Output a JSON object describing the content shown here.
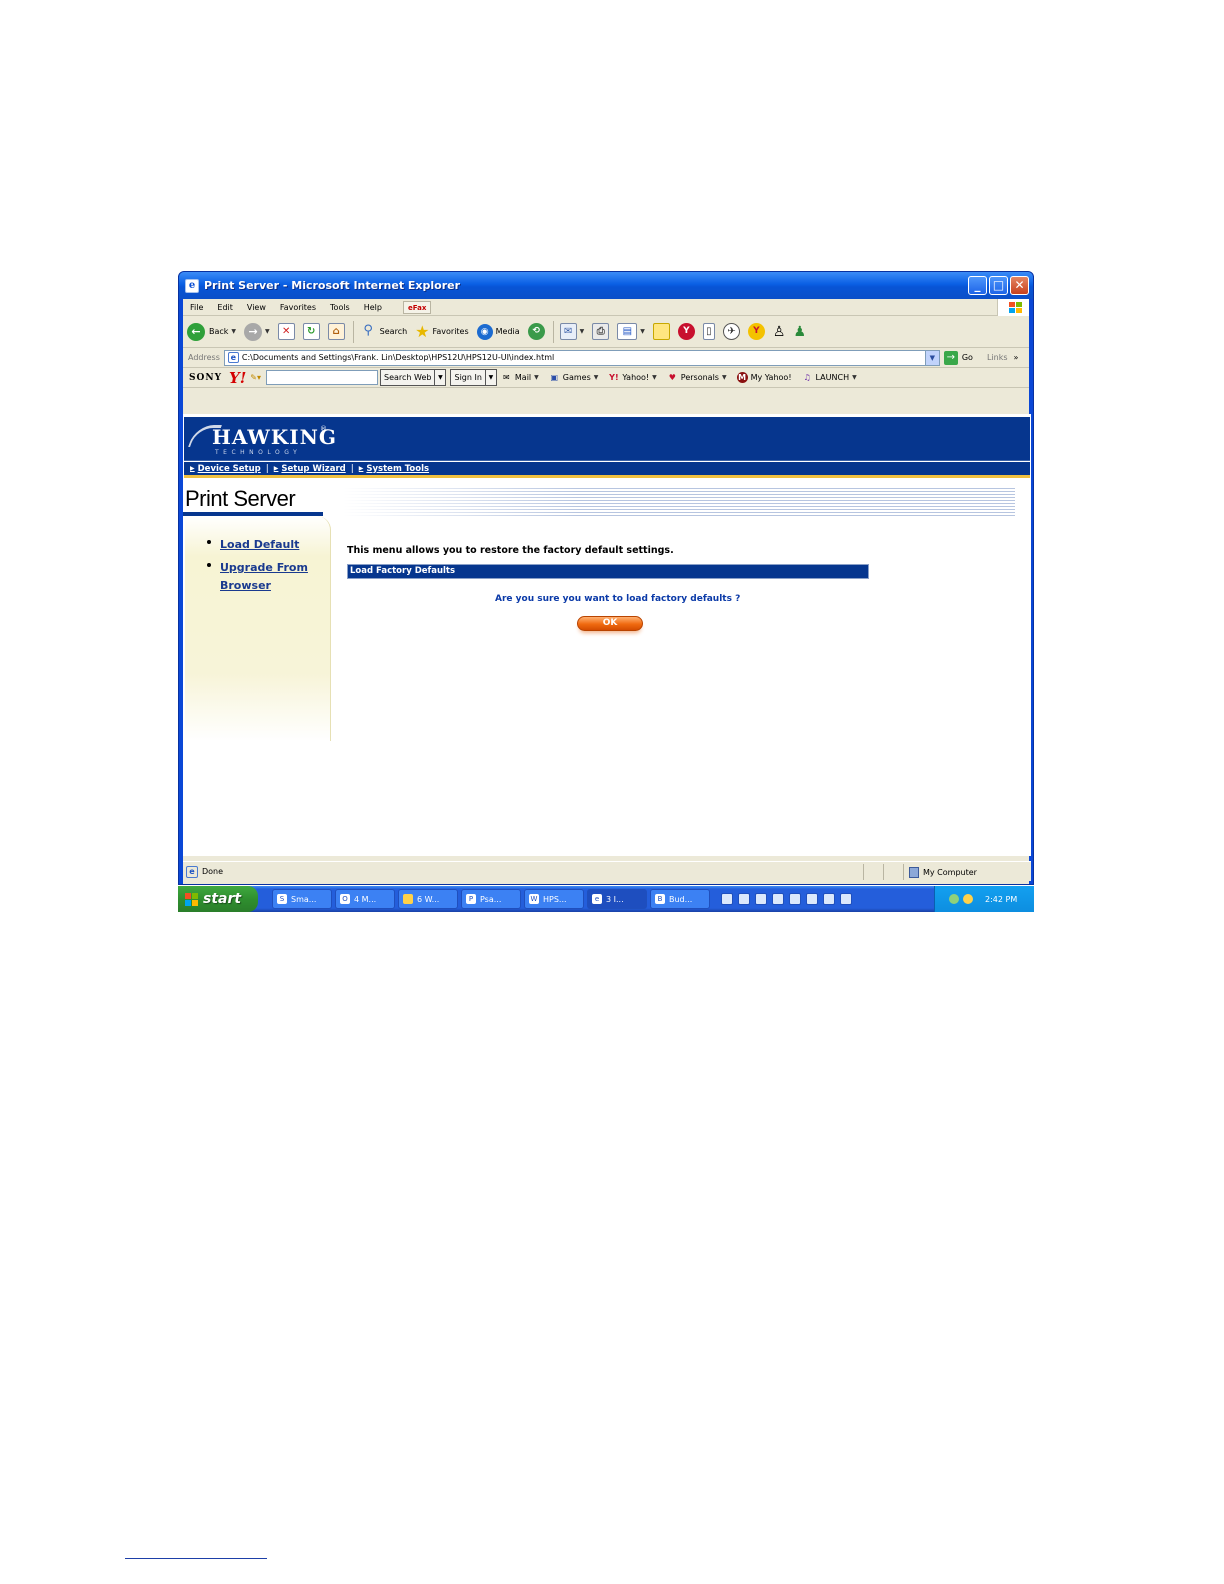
{
  "window": {
    "title": "Print Server - Microsoft Internet Explorer",
    "controls": {
      "minimize": "_",
      "maximize": "□",
      "close": "✕"
    }
  },
  "menubar": {
    "items": [
      "File",
      "Edit",
      "View",
      "Favorites",
      "Tools",
      "Help"
    ],
    "efax_label": "eFax"
  },
  "toolbar": {
    "back_label": "Back",
    "search_label": "Search",
    "favorites_label": "Favorites",
    "media_label": "Media"
  },
  "addressbar": {
    "label": "Address",
    "url": "C:\\Documents and Settings\\Frank. Lin\\Desktop\\HPS12U\\HPS12U-UI\\index.html",
    "go_label": "Go",
    "links_label": "Links"
  },
  "yahoo_toolbar": {
    "brand": "SONY",
    "logo": "Y!",
    "search_button": "Search Web",
    "signin_button": "Sign In",
    "items": [
      "Mail",
      "Games",
      "Yahoo!",
      "Personals",
      "My Yahoo!",
      "LAUNCH"
    ]
  },
  "page": {
    "logo_text": "HAWKING",
    "logo_sub": "TECHNOLOGY",
    "logo_reg": "®",
    "nav": [
      "Device Setup",
      "Setup Wizard",
      "System Tools"
    ],
    "nav_separator": "|",
    "title": "Print Server",
    "sidebar": [
      "Load Default",
      "Upgrade From Browser"
    ],
    "intro": "This menu allows you to restore the factory default settings.",
    "section_title": "Load Factory Defaults",
    "confirm_question": "Are you sure you want to load factory defaults ?",
    "ok_button": "OK"
  },
  "statusbar": {
    "status": "Done",
    "zone": "My Computer"
  },
  "taskbar": {
    "start_label": "start",
    "tasks": [
      "Sma...",
      "4 M...",
      "6 W...",
      "Psa...",
      "HPS...",
      "3 I...",
      "Bud..."
    ],
    "clock": "2:42 PM"
  },
  "colors": {
    "hawking_blue": "#06368e",
    "xp_blue": "#0a47d6",
    "ok_orange": "#f06a10",
    "sidebar_cream": "#f7f4d4"
  }
}
